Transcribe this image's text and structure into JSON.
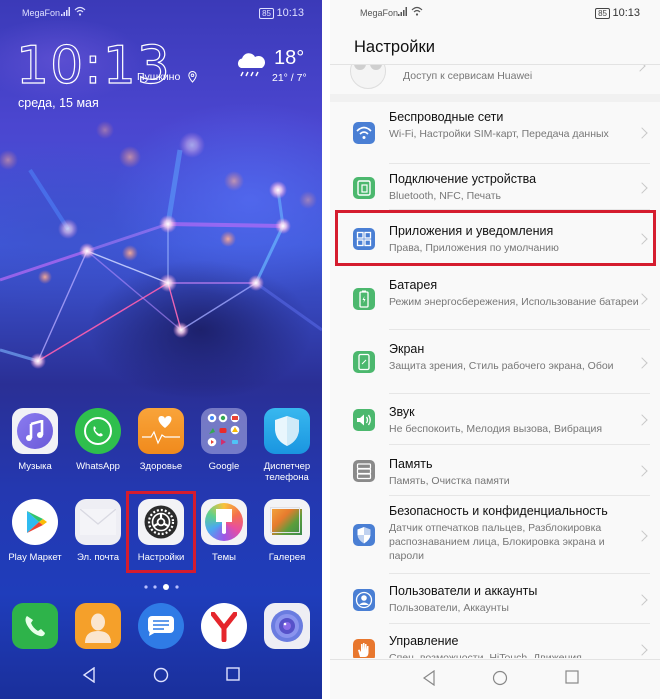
{
  "home": {
    "status_bar": {
      "carrier": "MegaFon",
      "battery": "85",
      "time": "10:13"
    },
    "clock": "10:13",
    "location": "Пушкино",
    "date": "среда, 15 мая",
    "weather": {
      "icon": "cloud-rain-icon",
      "temp": "18°",
      "range": "21° / 7°"
    },
    "apps_row1": [
      {
        "label": "Музыка",
        "icon": "music-icon"
      },
      {
        "label": "WhatsApp",
        "icon": "whatsapp-icon"
      },
      {
        "label": "Здоровье",
        "icon": "health-icon"
      },
      {
        "label": "Google",
        "icon": "google-folder-icon"
      },
      {
        "label": "Диспетчер телефона",
        "icon": "phone-manager-icon"
      }
    ],
    "apps_row2": [
      {
        "label": "Play Маркет",
        "icon": "play-store-icon"
      },
      {
        "label": "Эл. почта",
        "icon": "email-icon"
      },
      {
        "label": "Настройки",
        "icon": "settings-gear-icon"
      },
      {
        "label": "Темы",
        "icon": "themes-icon"
      },
      {
        "label": "Галерея",
        "icon": "gallery-icon"
      }
    ],
    "page_indicator": {
      "count": 4,
      "active": 3
    },
    "dock": [
      {
        "icon": "phone-icon"
      },
      {
        "icon": "contacts-icon"
      },
      {
        "icon": "messages-icon"
      },
      {
        "icon": "yandex-browser-icon"
      },
      {
        "icon": "camera-icon"
      }
    ],
    "highlight_color": "#d51c2e"
  },
  "settings": {
    "status_bar": {
      "carrier": "MegaFon",
      "battery": "85",
      "time": "10:13"
    },
    "title": "Настройки",
    "account_subtitle": "Доступ к сервисам Huawei",
    "items": [
      {
        "title": "Беспроводные сети",
        "subtitle": "Wi-Fi, Настройки SIM-карт, Передача данных",
        "icon": "wifi-icon",
        "color": "#4a7fd4"
      },
      {
        "title": "Подключение устройства",
        "subtitle": "Bluetooth, NFC, Печать",
        "icon": "device-connection-icon",
        "color": "#4cb86e"
      },
      {
        "title": "Приложения и уведомления",
        "subtitle": "Права, Приложения по умолчанию",
        "icon": "apps-grid-icon",
        "color": "#4a7fd4"
      },
      {
        "title": "Батарея",
        "subtitle": "Режим энергосбережения, Использование батареи",
        "icon": "battery-icon",
        "color": "#4cb86e"
      },
      {
        "title": "Экран",
        "subtitle": "Защита зрения, Стиль рабочего экрана, Обои",
        "icon": "display-icon",
        "color": "#4cb86e"
      },
      {
        "title": "Звук",
        "subtitle": "Не беспокоить, Мелодия вызова, Вибрация",
        "icon": "sound-icon",
        "color": "#4cb86e"
      },
      {
        "title": "Память",
        "subtitle": "Память, Очистка памяти",
        "icon": "storage-icon",
        "color": "#8a8a8a"
      },
      {
        "title": "Безопасность и конфиденциальность",
        "subtitle": "Датчик отпечатков пальцев, Разблокировка распознаванием лица, Блокировка экрана и пароли",
        "icon": "shield-icon",
        "color": "#4a7fd4"
      },
      {
        "title": "Пользователи и аккаунты",
        "subtitle": "Пользователи, Аккаунты",
        "icon": "user-icon",
        "color": "#4a7fd4"
      },
      {
        "title": "Управление",
        "subtitle": "Спец. возможности, HiTouch, Движения",
        "icon": "hand-icon",
        "color": "#e8772e"
      }
    ],
    "highlighted_item": "Приложения и уведомления"
  }
}
